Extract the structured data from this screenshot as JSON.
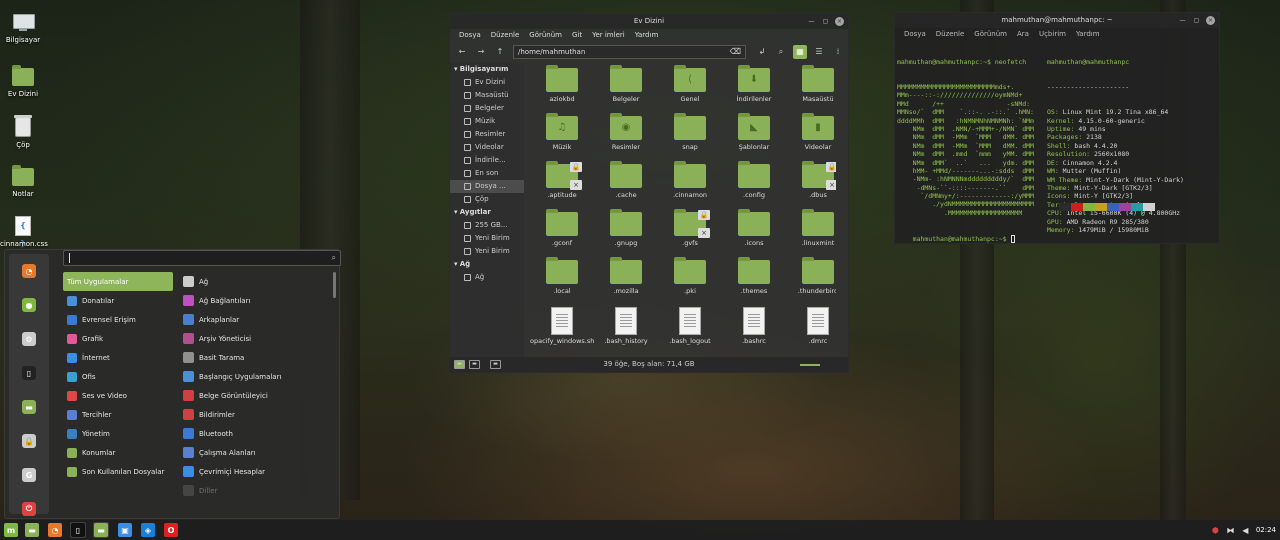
{
  "desktop": {
    "icons": [
      {
        "label": "Bilgisayar",
        "icon": "computer-icon"
      },
      {
        "label": "Ev Dizini",
        "icon": "home-folder-icon"
      },
      {
        "label": "Çöp",
        "icon": "trash-icon"
      },
      {
        "label": "Notlar",
        "icon": "folder-icon"
      },
      {
        "label": "cinnamon.css",
        "icon": "css-file-icon"
      }
    ]
  },
  "menu": {
    "search_value": "",
    "categories": [
      {
        "label": "Tüm Uygulamalar",
        "color": "#8fb55a"
      },
      {
        "label": "Donatılar",
        "color": "#4a90d9"
      },
      {
        "label": "Evrensel Erişim",
        "color": "#3a7bd5"
      },
      {
        "label": "Grafik",
        "color": "#e05a9a"
      },
      {
        "label": "İnternet",
        "color": "#3a8ee6"
      },
      {
        "label": "Ofis",
        "color": "#3aa0d0"
      },
      {
        "label": "Ses ve Video",
        "color": "#e04848"
      },
      {
        "label": "Tercihler",
        "color": "#5a7fd0"
      },
      {
        "label": "Yönetim",
        "color": "#3a80c0"
      },
      {
        "label": "Konumlar",
        "color": "#8bb158"
      },
      {
        "label": "Son Kullanılan Dosyalar",
        "color": "#8bb158"
      }
    ],
    "apps": [
      {
        "label": "Ağ",
        "color": "#cccccc"
      },
      {
        "label": "Ağ Bağlantıları",
        "color": "#c050c0"
      },
      {
        "label": "Arkaplanlar",
        "color": "#4a7fd0"
      },
      {
        "label": "Arşiv Yöneticisi",
        "color": "#b05090"
      },
      {
        "label": "Basit Tarama",
        "color": "#909090"
      },
      {
        "label": "Başlangıç Uygulamaları",
        "color": "#4a90d9"
      },
      {
        "label": "Belge Görüntüleyici",
        "color": "#d04040"
      },
      {
        "label": "Bildirimler",
        "color": "#d04040"
      },
      {
        "label": "Bluetooth",
        "color": "#3a7bd5"
      },
      {
        "label": "Çalışma Alanları",
        "color": "#5a80d0"
      },
      {
        "label": "Çevrimiçi Hesaplar",
        "color": "#3a8ee6"
      },
      {
        "label": "Diller",
        "color": "#777777"
      }
    ],
    "favorites": [
      {
        "icon": "firefox-icon",
        "color": "#e8792b"
      },
      {
        "icon": "software-manager-icon",
        "color": "#7fb83e"
      },
      {
        "icon": "settings-icon",
        "color": "#cccccc"
      },
      {
        "icon": "terminal-icon",
        "color": "#222222"
      },
      {
        "icon": "files-icon",
        "color": "#8bb158"
      },
      {
        "icon": "lock-icon",
        "color": "#cccccc"
      },
      {
        "icon": "logout-icon",
        "color": "#cccccc"
      },
      {
        "icon": "power-icon",
        "color": "#e04040"
      }
    ]
  },
  "file_manager": {
    "title": "Ev Dizini",
    "menus": [
      "Dosya",
      "Düzenle",
      "Görünüm",
      "Git",
      "Yer imleri",
      "Yardım"
    ],
    "path": "/home/mahmuthan",
    "sidebar": {
      "sections": [
        {
          "title": "Bilgisayarım",
          "items": [
            "Ev Dizini",
            "Masaüstü",
            "Belgeler",
            "Müzik",
            "Resimler",
            "Videolar",
            "İndirile...",
            "En son",
            "Dosya ...",
            "Çöp"
          ]
        },
        {
          "title": "Aygıtlar",
          "items": [
            "255 GB...",
            "Yeni Birim",
            "Yeni Birim"
          ]
        },
        {
          "title": "Ağ",
          "items": [
            "Ağ"
          ]
        }
      ]
    },
    "items": [
      {
        "name": "aziokbd",
        "kind": "folder",
        "glyph": ""
      },
      {
        "name": "Belgeler",
        "kind": "folder",
        "glyph": ""
      },
      {
        "name": "Genel",
        "kind": "folder",
        "glyph": "⟨"
      },
      {
        "name": "İndirilenler",
        "kind": "folder",
        "glyph": "⬇"
      },
      {
        "name": "Masaüstü",
        "kind": "folder",
        "glyph": ""
      },
      {
        "name": "Müzik",
        "kind": "folder",
        "glyph": "♫"
      },
      {
        "name": "Resimler",
        "kind": "folder",
        "glyph": "◉"
      },
      {
        "name": "snap",
        "kind": "folder",
        "glyph": ""
      },
      {
        "name": "Şablonlar",
        "kind": "folder",
        "glyph": "◣"
      },
      {
        "name": "Videolar",
        "kind": "folder",
        "glyph": "▮"
      },
      {
        "name": ".aptitude",
        "kind": "locked",
        "glyph": ""
      },
      {
        "name": ".cache",
        "kind": "folder",
        "glyph": ""
      },
      {
        "name": ".cinnamon",
        "kind": "folder",
        "glyph": ""
      },
      {
        "name": ".config",
        "kind": "folder",
        "glyph": ""
      },
      {
        "name": ".dbus",
        "kind": "locked",
        "glyph": ""
      },
      {
        "name": ".gconf",
        "kind": "folder",
        "glyph": ""
      },
      {
        "name": ".gnupg",
        "kind": "folder",
        "glyph": ""
      },
      {
        "name": ".gvfs",
        "kind": "locked",
        "glyph": ""
      },
      {
        "name": ".icons",
        "kind": "folder",
        "glyph": ""
      },
      {
        "name": ".linuxmint",
        "kind": "folder",
        "glyph": ""
      },
      {
        "name": ".local",
        "kind": "folder",
        "glyph": ""
      },
      {
        "name": ".mozilla",
        "kind": "folder",
        "glyph": ""
      },
      {
        "name": ".pki",
        "kind": "folder",
        "glyph": ""
      },
      {
        "name": ".themes",
        "kind": "folder",
        "glyph": ""
      },
      {
        "name": ".thunderbird",
        "kind": "folder",
        "glyph": ""
      },
      {
        "name": "opacify_windows.sh",
        "kind": "doc",
        "glyph": ""
      },
      {
        "name": ".bash_history",
        "kind": "doc",
        "glyph": ""
      },
      {
        "name": ".bash_logout",
        "kind": "doc",
        "glyph": ""
      },
      {
        "name": ".bashrc",
        "kind": "doc",
        "glyph": ""
      },
      {
        "name": ".dmrc",
        "kind": "doc",
        "glyph": ""
      }
    ],
    "status": "39 öğe, Boş alan: 71,4 GB"
  },
  "terminal": {
    "title": "mahmuthan@mahmuthanpc: ~",
    "menus": [
      "Dosya",
      "Düzenle",
      "Görünüm",
      "Ara",
      "Uçbirim",
      "Yardım"
    ],
    "command_line": "mahmuthan@mahmuthanpc:~$ neofetch",
    "logo": [
      "MMMMMMMMMMMMMMMMMMMMMMMMMmds+.",
      "MMm----::-://////////////oymNMd+",
      "MMd      /++                -sNMd:",
      "MMNso/`  dMM    `.::-. .-::.` .hMN:",
      "ddddMMh  dMM   :hNMNMNhNMNMNh: `NMm",
      "    NMm  dMM  .NMN/-+MMM+-/NMN` dMM",
      "    NMm  dMM  -MMm  `MMM   dMM. dMM",
      "    NMm  dMM  -MMm  `MMM   dMM. dMM",
      "    NMm  dMM  .mmd  `mmm   yMM. dMM",
      "    NMm  dMM`  ..`   ...   ydm. dMM",
      "    hMM- +MMd/-------...-:sdds  dMM",
      "    -NMm- :hNMNNNmdddddddddy/`  dMM",
      "     -dMNs-``-::::-------.``    dMM",
      "      `/dMNmy+/:-------------:/yMMM",
      "         ./ydNMMMMMMMMMMMMMMMMMMMMM",
      "            .MMMMMMMMMMMMMMMMMMM"
    ],
    "header": "mahmuthan@mahmuthanpc",
    "separator": "---------------------",
    "info": [
      {
        "key": "OS",
        "value": "Linux Mint 19.2 Tina x86_64"
      },
      {
        "key": "Kernel",
        "value": "4.15.0-60-generic"
      },
      {
        "key": "Uptime",
        "value": "49 mins"
      },
      {
        "key": "Packages",
        "value": "2138"
      },
      {
        "key": "Shell",
        "value": "bash 4.4.20"
      },
      {
        "key": "Resolution",
        "value": "2560x1080"
      },
      {
        "key": "DE",
        "value": "Cinnamon 4.2.4"
      },
      {
        "key": "WM",
        "value": "Mutter (Muffin)"
      },
      {
        "key": "WM Theme",
        "value": "Mint-Y-Dark (Mint-Y-Dark)"
      },
      {
        "key": "Theme",
        "value": "Mint-Y-Dark [GTK2/3]"
      },
      {
        "key": "Icons",
        "value": "Mint-Y [GTK2/3]"
      },
      {
        "key": "Terminal",
        "value": "gnome-terminal"
      },
      {
        "key": "CPU",
        "value": "Intel i5-6600K (4) @ 4.800GHz"
      },
      {
        "key": "GPU",
        "value": "AMD Radeon R9 285/380"
      },
      {
        "key": "Memory",
        "value": "1479MiB / 15980MiB"
      }
    ],
    "palette": [
      "#2b2b2b",
      "#cc2020",
      "#7fb83e",
      "#c8a020",
      "#3a60c0",
      "#a040a0",
      "#20a0a0",
      "#d0d0d0"
    ],
    "prompt": "mahmuthan@mahmuthanpc:~$ "
  },
  "taskbar": {
    "items": [
      {
        "icon": "mint-menu-icon",
        "color": "#7fb83e"
      },
      {
        "icon": "files-icon",
        "color": "#8bb158"
      },
      {
        "icon": "firefox-icon",
        "color": "#e8792b"
      },
      {
        "icon": "terminal-icon",
        "color": "#111111"
      },
      {
        "icon": "files-window-icon",
        "color": "#8bb158"
      },
      {
        "icon": "chat-icon",
        "color": "#3a8ee6"
      },
      {
        "icon": "teamviewer-icon",
        "color": "#1a7fd6"
      },
      {
        "icon": "opera-icon",
        "color": "#e02020"
      }
    ],
    "clock": "02:24"
  }
}
